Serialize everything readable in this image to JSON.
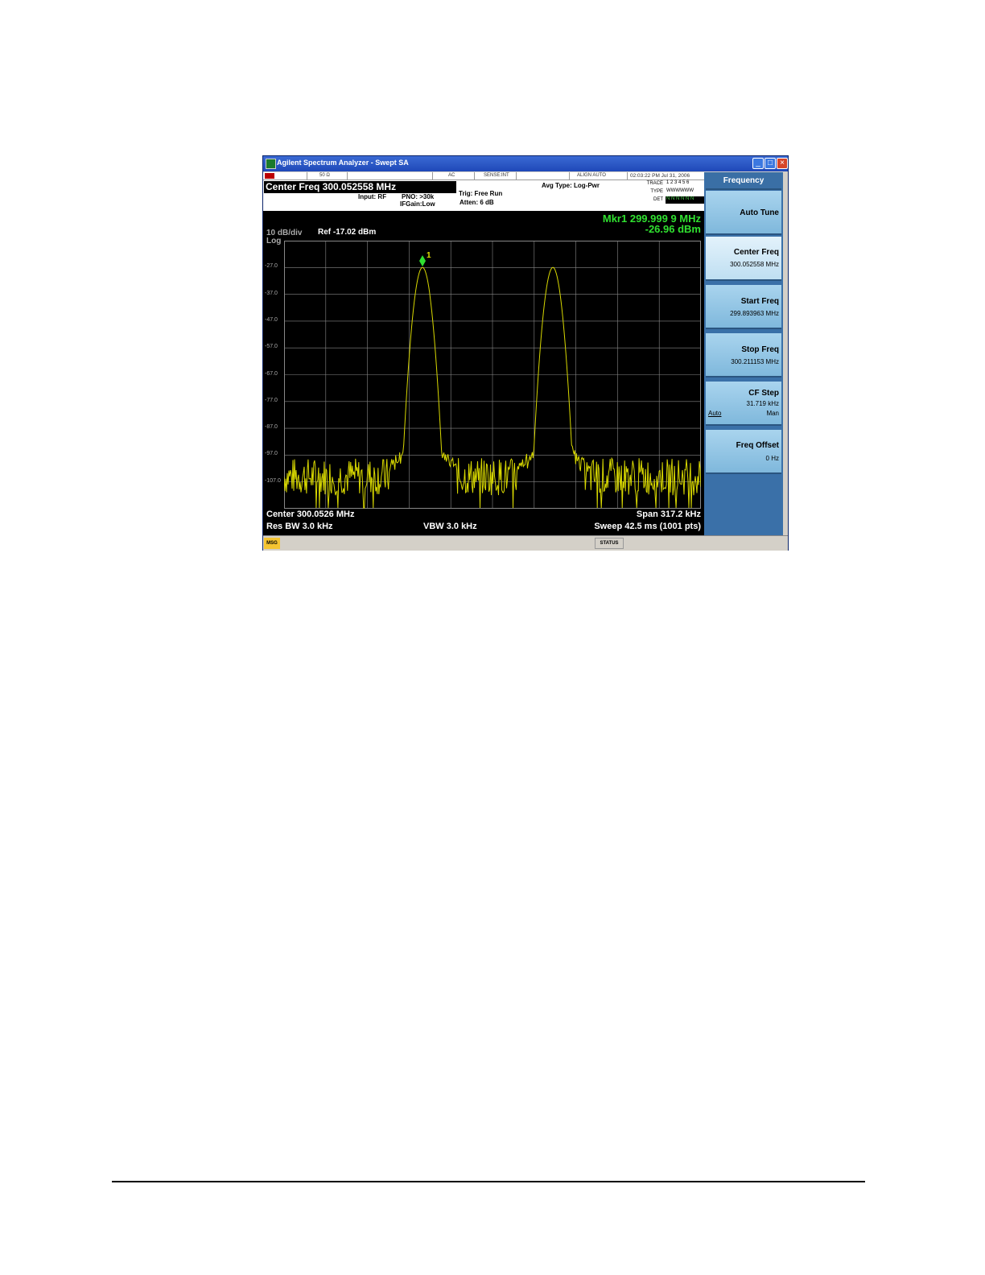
{
  "window": {
    "title": "Agilent Spectrum Analyzer - Swept SA"
  },
  "status_strip": {
    "impedance": "50 Ω",
    "coupling": "AC",
    "sense": "SENSE:INT",
    "align": "ALIGN AUTO",
    "datetime": "02:03:22 PM Jul 31, 2006"
  },
  "header": {
    "center_freq": "Center Freq  300.052558 MHz",
    "input": "Input: RF",
    "pno": "PNO: >30k",
    "ifgain": "IFGain:Low",
    "trig": "Trig: Free Run",
    "atten": "Atten: 6 dB",
    "avg_type": "Avg Type: Log-Pwr",
    "trace_label": "TRACE",
    "trace_values": "1 2 3 4 5 6",
    "type_label": "TYPE",
    "type_values": "WWWWWW",
    "det_label": "DET",
    "det_values": "N N N N N N"
  },
  "display": {
    "scale": "10 dB/div",
    "log": "Log",
    "ref_level": "Ref -17.02 dBm",
    "marker_freq": "Mkr1 299.999 9 MHz",
    "marker_amp": "-26.96 dBm",
    "marker_number": "1",
    "center": "Center 300.0526 MHz",
    "res_bw": "Res BW 3.0 kHz",
    "vbw": "VBW 3.0 kHz",
    "span": "Span 317.2 kHz",
    "sweep": "Sweep  42.5 ms (1001 pts)",
    "y_ticks": [
      "-27.0",
      "-37.0",
      "-47.0",
      "-57.0",
      "-67.0",
      "-77.0",
      "-87.0",
      "-97.0",
      "-107.0"
    ],
    "trace_color": "#d8d800",
    "grid_color": "#888888"
  },
  "softkeys": {
    "menu_title": "Frequency",
    "auto_tune": "Auto Tune",
    "center_freq_label": "Center Freq",
    "center_freq_value": "300.052558 MHz",
    "start_freq_label": "Start Freq",
    "start_freq_value": "299.893963 MHz",
    "stop_freq_label": "Stop Freq",
    "stop_freq_value": "300.211153 MHz",
    "cf_step_label": "CF Step",
    "cf_step_value": "31.719 kHz",
    "cf_step_auto": "Auto",
    "cf_step_man": "Man",
    "freq_offset_label": "Freq Offset",
    "freq_offset_value": "0 Hz"
  },
  "statusbar": {
    "msg": "MSG",
    "status": "STATUS"
  }
}
